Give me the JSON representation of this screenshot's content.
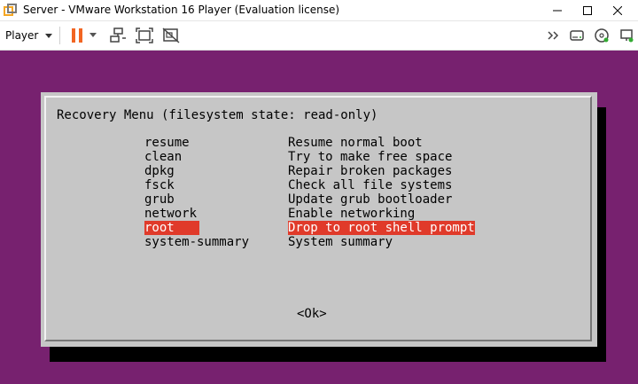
{
  "window": {
    "title": "Server - VMware Workstation 16 Player (Evaluation license)"
  },
  "toolbar": {
    "player_label": "Player"
  },
  "vm": {
    "background_color": "#77216f",
    "dialog": {
      "title": "Recovery Menu (filesystem state: read-only)",
      "highlight_color": "#e03a2a",
      "items": [
        {
          "key": "resume",
          "desc": "Resume normal boot"
        },
        {
          "key": "clean",
          "desc": "Try to make free space"
        },
        {
          "key": "dpkg",
          "desc": "Repair broken packages"
        },
        {
          "key": "fsck",
          "desc": "Check all file systems"
        },
        {
          "key": "grub",
          "desc": "Update grub bootloader"
        },
        {
          "key": "network",
          "desc": "Enable networking"
        },
        {
          "key": "root",
          "desc": "Drop to root shell prompt",
          "selected": true
        },
        {
          "key": "system-summary",
          "desc": "System summary"
        }
      ],
      "ok_label": "<Ok>"
    }
  }
}
